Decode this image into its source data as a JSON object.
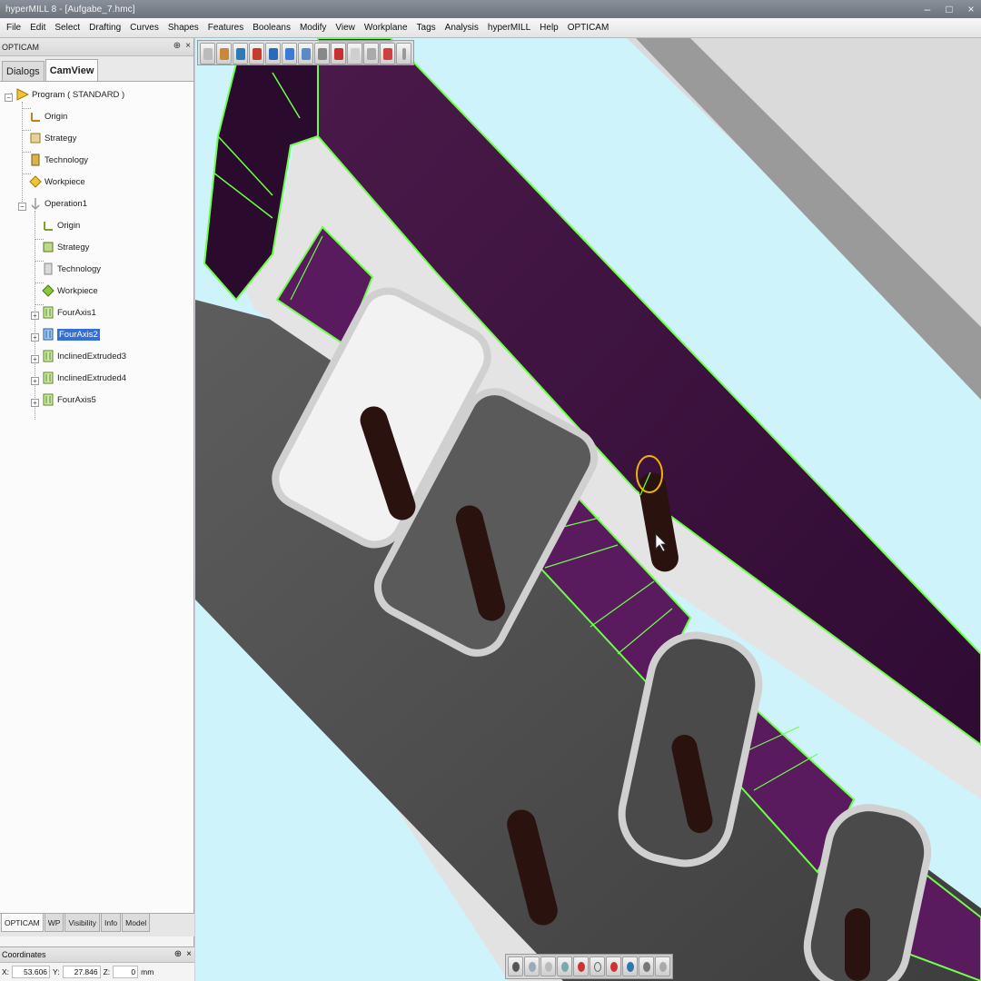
{
  "window": {
    "title": "hyperMILL 8 - [Aufgabe_7.hmc]",
    "controls": [
      "–",
      "□",
      "×"
    ]
  },
  "menu": [
    "File",
    "Edit",
    "Select",
    "Drafting",
    "Curves",
    "Shapes",
    "Features",
    "Booleans",
    "Modify",
    "View",
    "Workplane",
    "Tags",
    "Analysis",
    "hyperMILL",
    "Help",
    "OPTICAM"
  ],
  "panel": {
    "title": "OPTICAM",
    "tabs": [
      "Dialogs",
      "CamView"
    ],
    "active_tab": "CamView"
  },
  "tree": {
    "program": "Program ( STANDARD )",
    "program_children": [
      "Origin",
      "Strategy",
      "Technology",
      "Workpiece"
    ],
    "operation": "Operation1",
    "operation_children": [
      "Origin",
      "Strategy",
      "Technology",
      "Workpiece"
    ],
    "features": [
      "FourAxis1",
      "FourAxis2",
      "InclinedExtruded3",
      "InclinedExtruded4",
      "FourAxis5"
    ],
    "selected_feature": "FourAxis2"
  },
  "bottom_tabs": [
    "OPTICAM",
    "WP",
    "Visibility",
    "Info",
    "Model"
  ],
  "coordinates": {
    "title": "Coordinates",
    "x_label": "X:",
    "x": "53.606",
    "y_label": "Y:",
    "y": "27.846",
    "z_label": "Z:",
    "z": "0",
    "unit": "mm"
  },
  "colors": {
    "viewport_bg": "#cff3fb",
    "pocket_floor": "#3d0f3d",
    "toolpath": "#7cff5a",
    "selection": "#3270d8"
  }
}
